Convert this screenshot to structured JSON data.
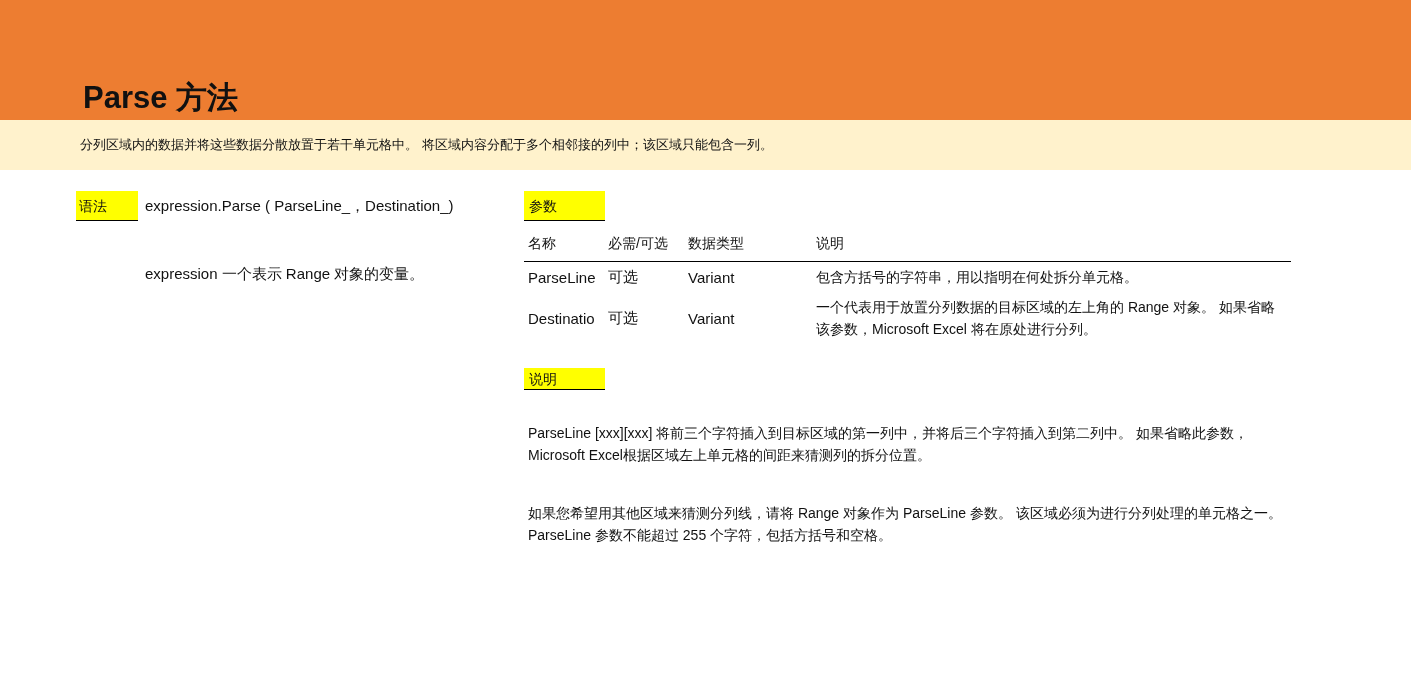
{
  "title": "Parse 方法",
  "summary": "分列区域内的数据并将这些数据分散放置于若干单元格中。 将区域内容分配于多个相邻接的列中；该区域只能包含一列。",
  "syntax": {
    "label": "语法",
    "code": "expression.Parse ( ParseLine_，Destination_)",
    "note": "expression 一个表示 Range 对象的变量。"
  },
  "parameters": {
    "label": "参数",
    "columns": [
      "名称",
      "必需/可选",
      "数据类型",
      "说明"
    ],
    "rows": [
      [
        "ParseLine",
        "可选",
        "Variant",
        "包含方括号的字符串，用以指明在何处拆分单元格。"
      ],
      [
        "Destinatio",
        "可选",
        "Variant",
        "一个代表用于放置分列数据的目标区域的左上角的 Range 对象。 如果省略该参数，Microsoft Excel 将在原处进行分列。"
      ]
    ]
  },
  "remarks": {
    "label": "说明",
    "paragraphs": [
      "ParseLine [xxx][xxx] 将前三个字符插入到目标区域的第一列中，并将后三个字符插入到第二列中。 如果省略此参数，Microsoft Excel根据区域左上单元格的间距来猜测列的拆分位置。",
      "如果您希望用其他区域来猜测分列线，请将 Range 对象作为 ParseLine 参数。 该区域必须为进行分列处理的单元格之一。 ParseLine 参数不能超过 255 个字符，包括方括号和空格。"
    ]
  }
}
